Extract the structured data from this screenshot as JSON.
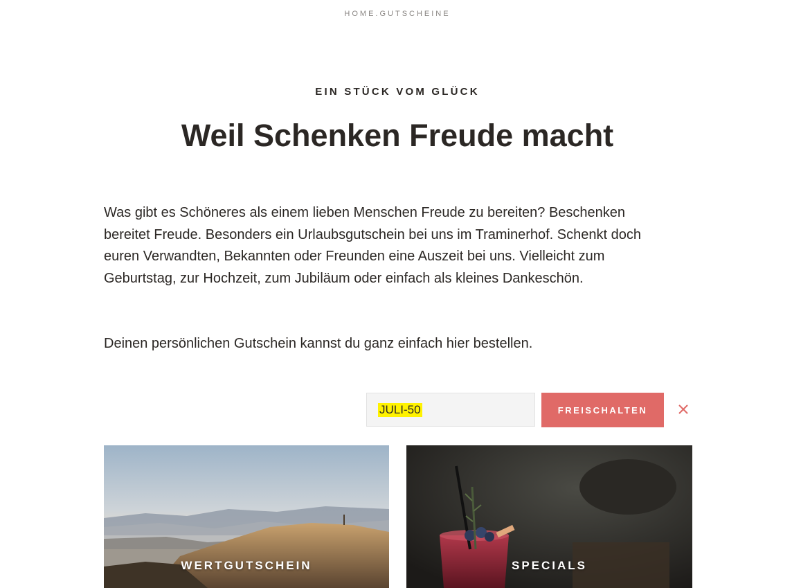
{
  "breadcrumb": {
    "home": "HOME",
    "separator": ".",
    "current": "GUTSCHEINE"
  },
  "header": {
    "kicker": "EIN STÜCK VOM GLÜCK",
    "title": "Weil Schenken Freude macht"
  },
  "content": {
    "paragraph_1": "Was gibt es Schöneres als einem lieben Menschen Freude zu bereiten? Beschenken bereitet Freude. Besonders ein Urlaubsgutschein bei uns im Traminerhof. Schenkt doch euren Verwandten, Bekannten oder Freunden eine Auszeit bei uns. Vielleicht zum Geburtstag, zur Hochzeit, zum Jubiläum oder einfach als kleines Dankeschön.",
    "paragraph_2": "Deinen persönlichen Gutschein kannst du ganz einfach hier bestellen."
  },
  "voucher_form": {
    "code_value": "JULI-50",
    "unlock_label": "FREISCHALTEN",
    "clear_icon": "close-icon"
  },
  "cards": [
    {
      "label": "WERTGUTSCHEIN",
      "image": "mountain-landscape"
    },
    {
      "label": "SPECIALS",
      "image": "cocktail-drink"
    }
  ],
  "colors": {
    "text": "#2b2724",
    "accent_button": "#e06a67",
    "muted": "#8a8683",
    "highlight": "#fff200"
  }
}
